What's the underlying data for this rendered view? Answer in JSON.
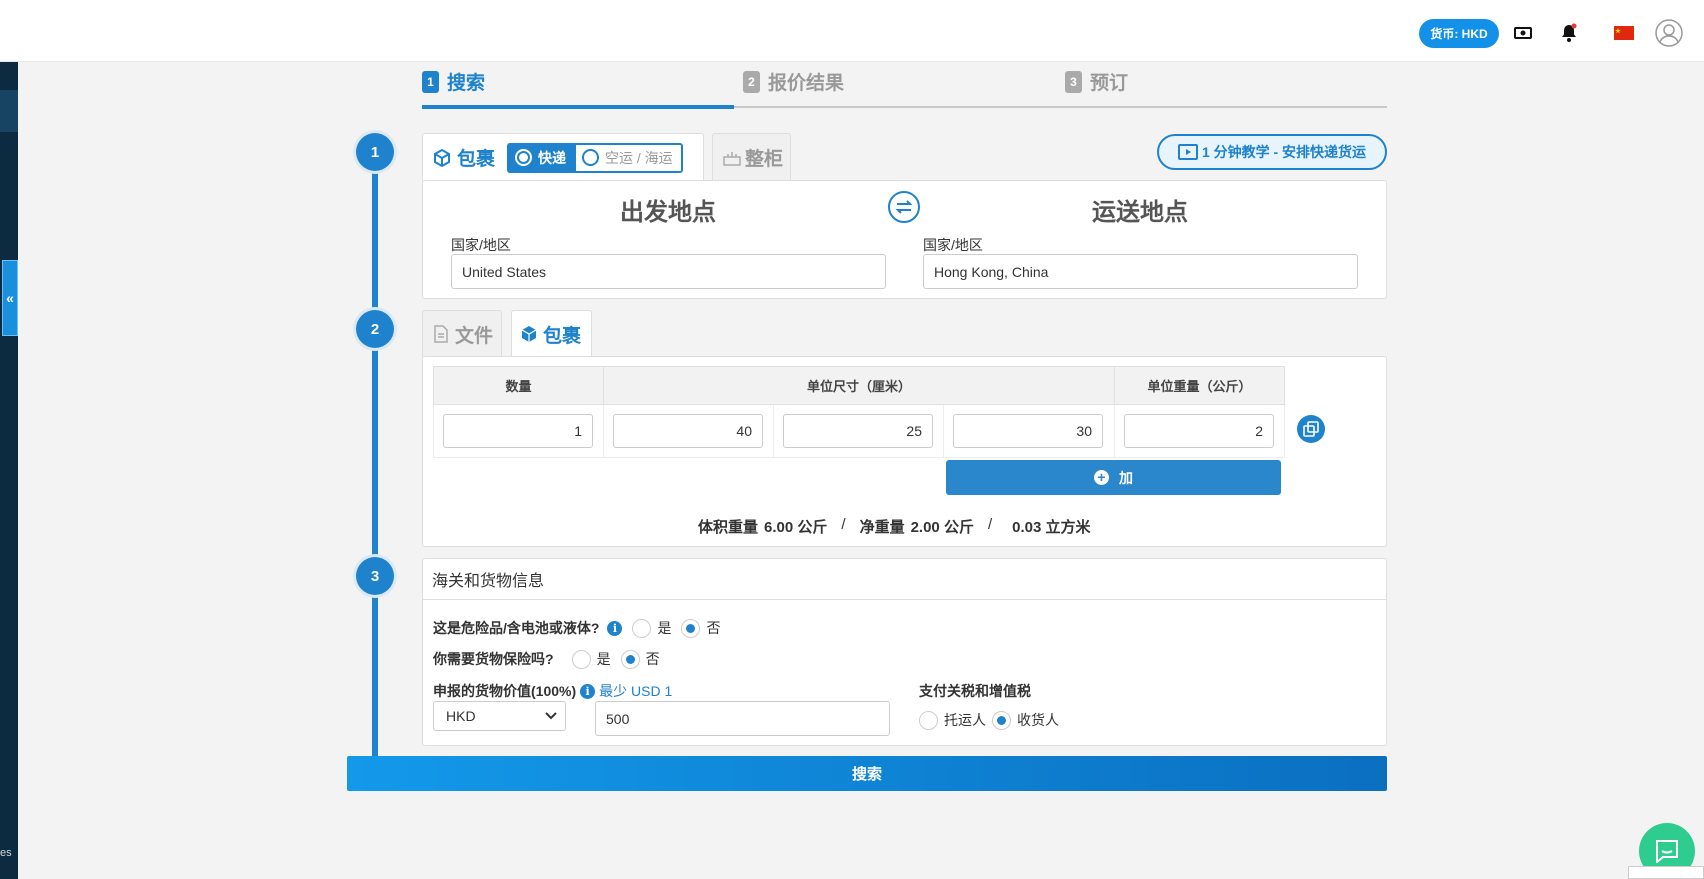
{
  "header": {
    "currency_pill": "货币: HKD",
    "icons": [
      "cash-icon",
      "bell-icon",
      "china-flag-icon",
      "user-icon"
    ]
  },
  "sidebar": {
    "collapse_label": "«",
    "bottom_text": "es"
  },
  "steps": [
    {
      "num": "1",
      "label": "搜索",
      "active": true
    },
    {
      "num": "2",
      "label": "报价结果",
      "active": false
    },
    {
      "num": "3",
      "label": "预订",
      "active": false
    }
  ],
  "section_numbers": [
    "1",
    "2",
    "3"
  ],
  "shipment": {
    "parcel_tab": "包裹",
    "express_option": "快递",
    "air_sea_option": "空运 / 海运",
    "container_tab": "整柜",
    "tutorial_button": "1 分钟教学 - 安排快递货运"
  },
  "origin": {
    "title": "出发地点",
    "country_label": "国家/地区",
    "country_value": "United States"
  },
  "destination": {
    "title": "运送地点",
    "country_label": "国家/地区",
    "country_value": "Hong Kong, China"
  },
  "package": {
    "document_tab": "文件",
    "parcel_tab": "包裹",
    "headers": {
      "quantity": "数量",
      "dimensions": "单位尺寸（厘米）",
      "weight": "单位重量（公斤）"
    },
    "row": {
      "quantity": "1",
      "length": "40",
      "width": "25",
      "height": "30",
      "weight": "2"
    },
    "add_button": "加",
    "totals": {
      "volumetric_label": "体积重量",
      "volumetric_value": "6.00 公斤",
      "net_label": "净重量",
      "net_value": "2.00 公斤",
      "volume_value": "0.03 立方米",
      "separator": "/"
    }
  },
  "customs": {
    "title": "海关和货物信息",
    "dangerous_q": "这是危险品/含电池或液体?",
    "insurance_q": "你需要货物保险吗?",
    "yes": "是",
    "no": "否",
    "declared_label": "申报的货物价值(100%)",
    "min_note": "最少 USD 1",
    "currency_select": "HKD",
    "declared_value": "500",
    "duty_label": "支付关税和增值税",
    "shipper": "托运人",
    "consignee": "收货人"
  },
  "search_button": "搜索",
  "colors": {
    "accent": "#1e82cc",
    "sidebar": "#0d2b40",
    "chat": "#2ecc8f"
  }
}
